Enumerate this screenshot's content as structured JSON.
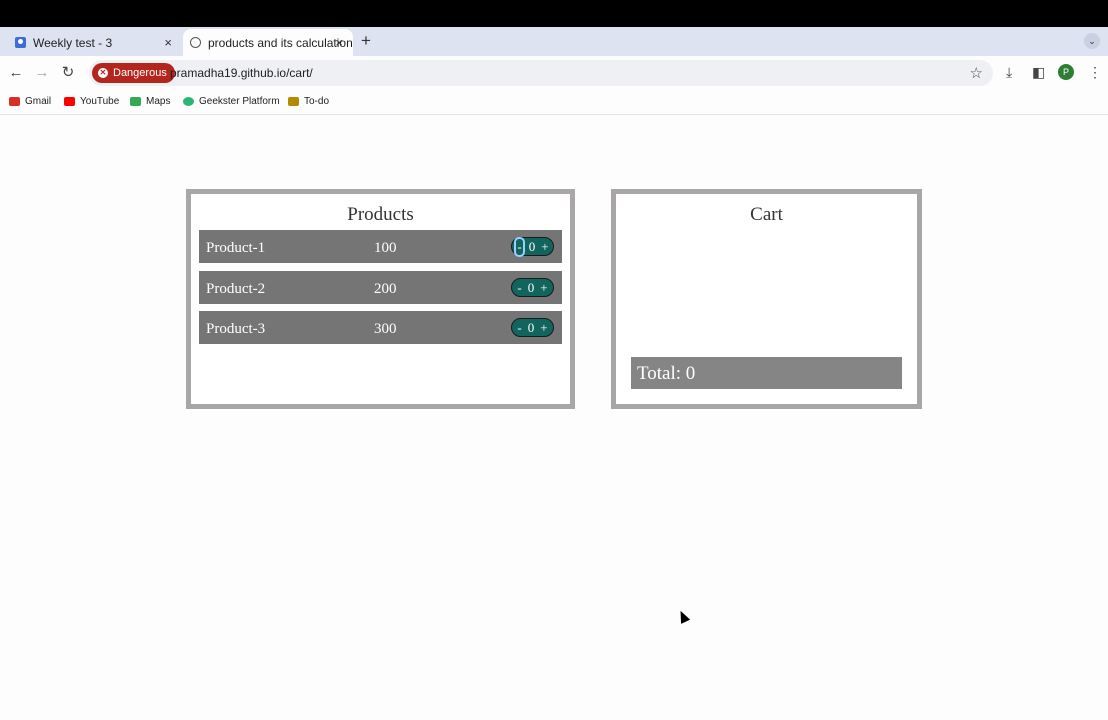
{
  "tabs": [
    {
      "title": "Weekly test - 3",
      "close": "×"
    },
    {
      "title": "products and its calculation",
      "close": "×"
    }
  ],
  "new_tab": "+",
  "tab_search": "⌄",
  "toolbar": {
    "back": "←",
    "forward": "→",
    "reload": "↻",
    "security_label": "Dangerous",
    "url": "pramadha19.github.io/cart/",
    "star": "☆",
    "download": "⤓",
    "sidepanel": "◧",
    "profile_initial": "P",
    "menu": "⋮"
  },
  "bookmarks": [
    {
      "label": "Gmail",
      "color": "#d93025"
    },
    {
      "label": "YouTube",
      "color": "#ff0000"
    },
    {
      "label": "Maps",
      "color": "#34a853"
    },
    {
      "label": "Geekster Platform",
      "color": "#2bb673"
    },
    {
      "label": "To-do",
      "color": "#b58900"
    }
  ],
  "products": {
    "title": "Products",
    "items": [
      {
        "name": "Product-1",
        "price": "100",
        "minus": "-",
        "qty": "0",
        "plus": "+"
      },
      {
        "name": "Product-2",
        "price": "200",
        "minus": "-",
        "qty": "0",
        "plus": "+"
      },
      {
        "name": "Product-3",
        "price": "300",
        "minus": "-",
        "qty": "0",
        "plus": "+"
      }
    ]
  },
  "cart": {
    "title": "Cart",
    "total": "Total: 0"
  }
}
